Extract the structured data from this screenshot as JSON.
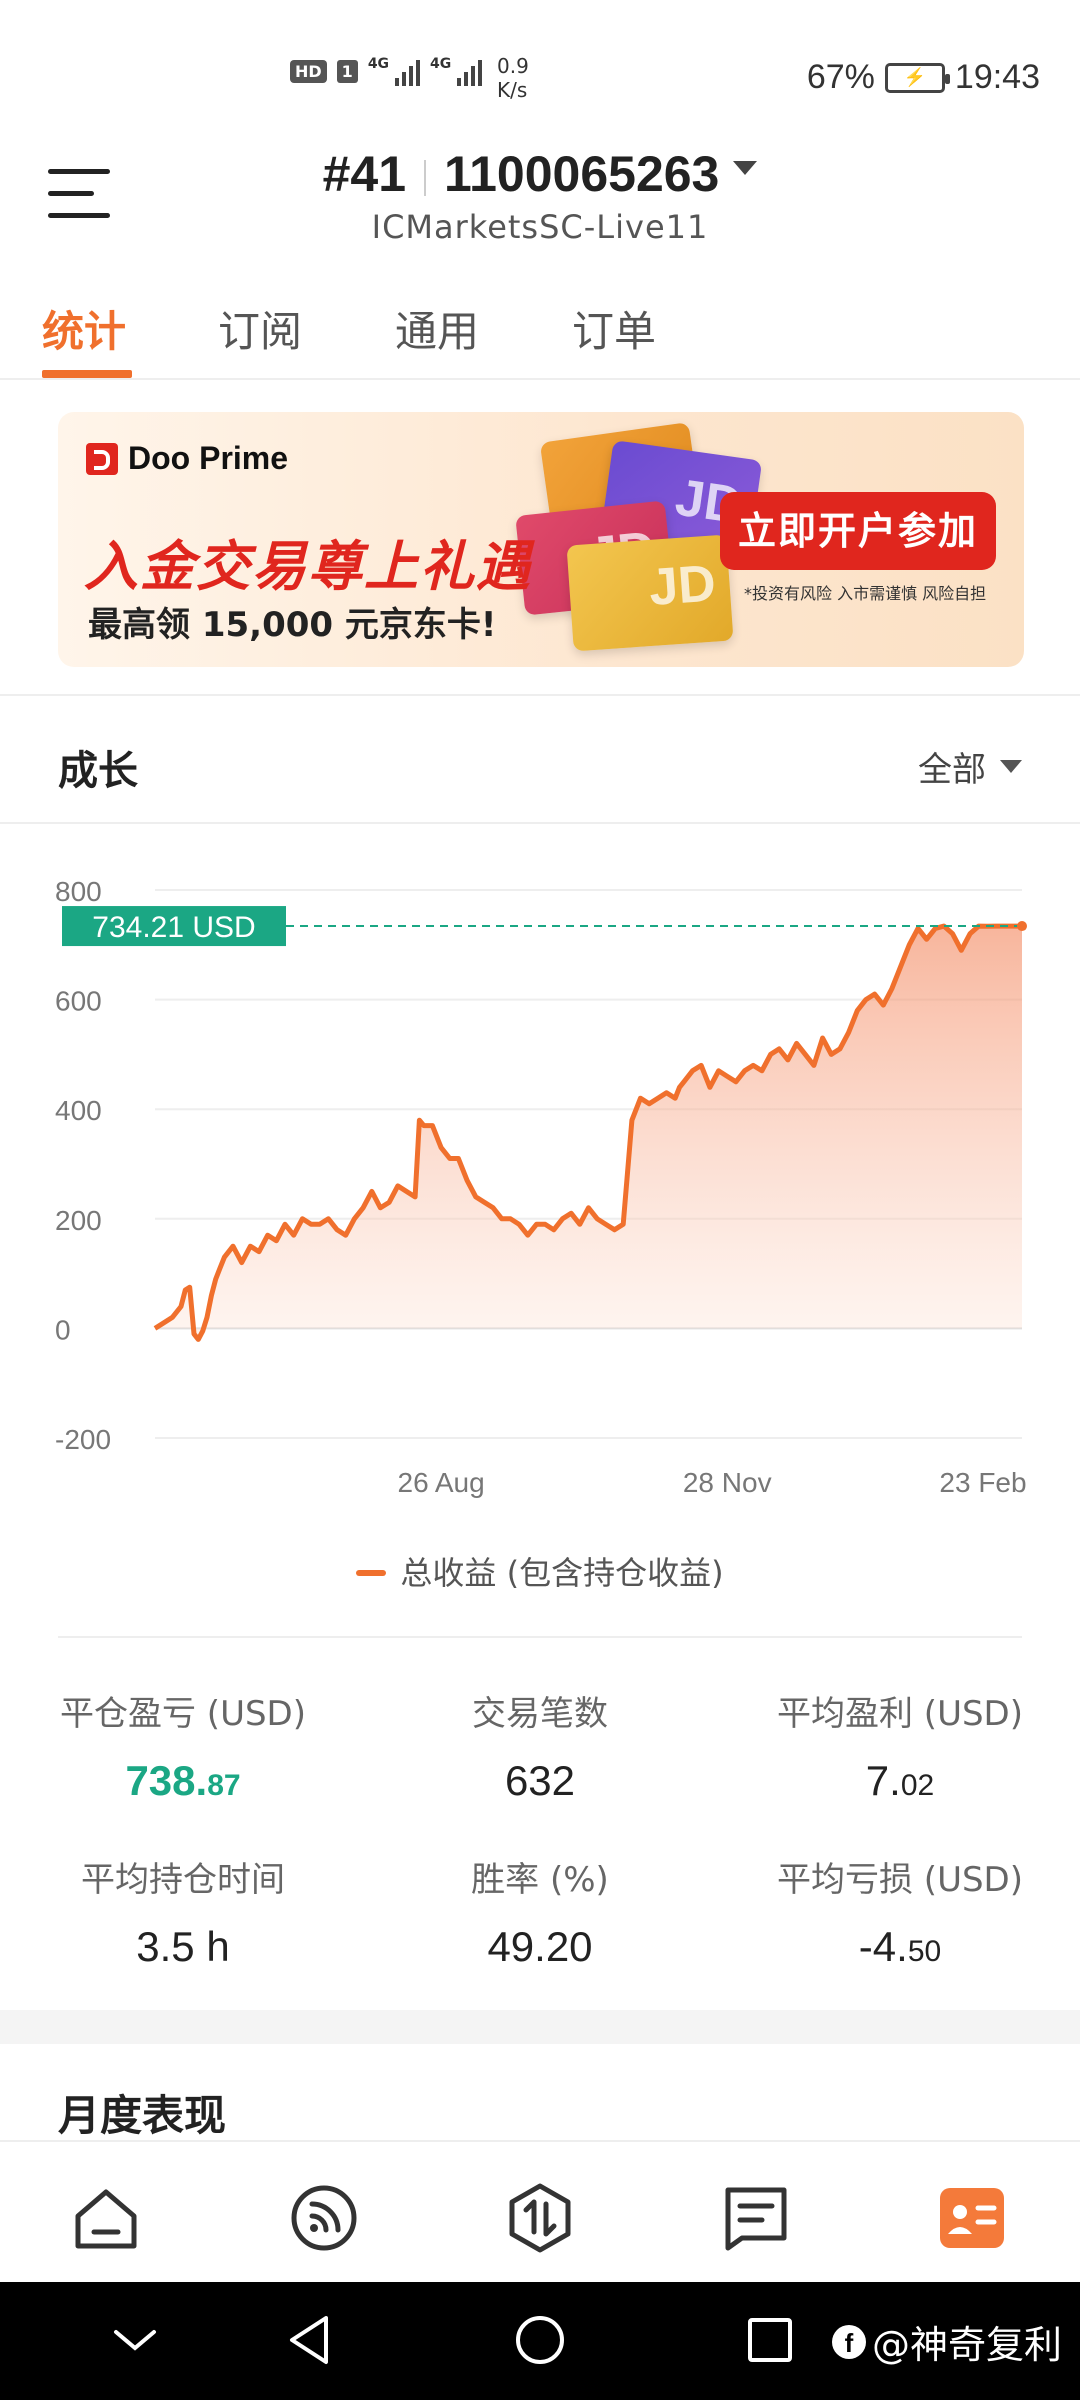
{
  "status_bar": {
    "hd": "HD",
    "sim": "1",
    "signal1": "4G",
    "signal2": "4G",
    "net_speed_value": "0.9",
    "net_speed_unit": "K/s",
    "battery_percent": "67%",
    "time": "19:43"
  },
  "header": {
    "account_rank": "#41",
    "account_number": "1100065263",
    "server": "ICMarketsSC-Live11"
  },
  "tabs": [
    {
      "label": "统计",
      "active": true
    },
    {
      "label": "订阅",
      "active": false
    },
    {
      "label": "通用",
      "active": false
    },
    {
      "label": "订单",
      "active": false
    }
  ],
  "banner": {
    "brand": "Doo Prime",
    "headline": "入金交易尊上礼遇",
    "subline": "最高领 15,000 元京东卡!",
    "cta": "立即开户参加",
    "disclaimer": "*投资有风险 入市需谨慎 风险自担",
    "card_label": "JD"
  },
  "growth": {
    "title": "成长",
    "filter": "全部"
  },
  "chart_data": {
    "type": "area",
    "current_value_label": "734.21 USD",
    "current_value": 734.21,
    "ylim": [
      -200,
      800
    ],
    "yticks": [
      800,
      600,
      400,
      200,
      0,
      -200
    ],
    "xtick_labels": [
      "26 Aug",
      "28 Nov",
      "23 Feb"
    ],
    "xtick_positions": [
      0.33,
      0.66,
      0.955
    ],
    "series": [
      {
        "name": "总收益 (包含持仓收益)",
        "color": "#f0702d",
        "x": [
          0,
          0.01,
          0.02,
          0.03,
          0.035,
          0.04,
          0.045,
          0.05,
          0.055,
          0.06,
          0.065,
          0.07,
          0.075,
          0.08,
          0.085,
          0.09,
          0.1,
          0.11,
          0.12,
          0.13,
          0.14,
          0.15,
          0.16,
          0.17,
          0.18,
          0.19,
          0.2,
          0.21,
          0.22,
          0.23,
          0.24,
          0.25,
          0.26,
          0.27,
          0.28,
          0.29,
          0.3,
          0.305,
          0.31,
          0.32,
          0.33,
          0.34,
          0.35,
          0.36,
          0.37,
          0.38,
          0.39,
          0.4,
          0.41,
          0.42,
          0.43,
          0.44,
          0.45,
          0.46,
          0.47,
          0.48,
          0.49,
          0.5,
          0.51,
          0.52,
          0.53,
          0.54,
          0.55,
          0.56,
          0.57,
          0.58,
          0.59,
          0.6,
          0.605,
          0.61,
          0.62,
          0.63,
          0.64,
          0.65,
          0.66,
          0.67,
          0.68,
          0.69,
          0.7,
          0.71,
          0.72,
          0.73,
          0.74,
          0.75,
          0.76,
          0.77,
          0.78,
          0.79,
          0.8,
          0.81,
          0.82,
          0.83,
          0.84,
          0.85,
          0.86,
          0.87,
          0.88,
          0.89,
          0.9,
          0.91,
          0.92,
          0.93,
          0.94,
          0.95,
          0.96,
          0.97,
          0.98,
          0.99,
          1.0
        ],
        "y": [
          0,
          10,
          20,
          40,
          70,
          75,
          -10,
          -20,
          -5,
          20,
          60,
          90,
          110,
          130,
          140,
          150,
          120,
          150,
          140,
          170,
          160,
          190,
          170,
          200,
          190,
          190,
          200,
          180,
          170,
          200,
          220,
          250,
          220,
          230,
          260,
          250,
          240,
          380,
          370,
          370,
          330,
          310,
          310,
          270,
          240,
          230,
          220,
          200,
          200,
          190,
          170,
          190,
          190,
          180,
          200,
          210,
          190,
          220,
          200,
          190,
          180,
          190,
          380,
          420,
          410,
          420,
          430,
          420,
          440,
          450,
          470,
          480,
          440,
          470,
          460,
          450,
          470,
          480,
          470,
          500,
          510,
          490,
          520,
          500,
          480,
          530,
          500,
          510,
          540,
          580,
          600,
          610,
          590,
          620,
          660,
          700,
          730,
          710,
          730,
          734.21,
          720,
          690,
          720,
          734.21,
          734,
          734.21,
          734.21,
          734.21,
          734.21
        ]
      }
    ]
  },
  "stats": [
    {
      "label": "平仓盈亏 (USD)",
      "int": "738.",
      "dec": "87",
      "green": true
    },
    {
      "label": "交易笔数",
      "int": "632",
      "dec": "",
      "green": false
    },
    {
      "label": "平均盈利 (USD)",
      "int": "7.",
      "dec": "02",
      "green": false
    },
    {
      "label": "平均持仓时间",
      "int": "3.5 h",
      "dec": "",
      "green": false
    },
    {
      "label": "胜率 (%)",
      "int": "49.20",
      "dec": "",
      "green": false
    },
    {
      "label": "平均亏损 (USD)",
      "int": "-4.",
      "dec": "50",
      "green": false
    }
  ],
  "monthly": {
    "title": "月度表现"
  },
  "bottom_nav": {
    "items": [
      "home-icon",
      "subscriptions-icon",
      "trade-icon",
      "messages-icon",
      "profile-card-icon"
    ],
    "accent": "#f47a3a"
  },
  "watermark": "@神奇复利"
}
